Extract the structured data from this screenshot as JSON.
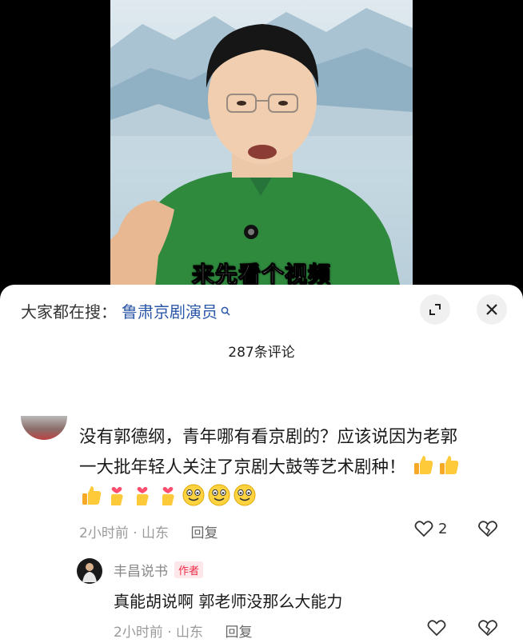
{
  "video": {
    "caption": "来先看个视频"
  },
  "search": {
    "prefix": "大家都在搜：",
    "term": "鲁肃京剧演员"
  },
  "comments_header": {
    "count_text": "287条评论"
  },
  "comment": {
    "line1": "没有郭德纲，青年哪有看京剧的？应该说因为老郭",
    "line2": "一大批年轻人关注了京剧大鼓等艺术剧种！",
    "emojis_line2": [
      "thumbs-up",
      "thumbs-up"
    ],
    "emojis_line3": [
      "thumbs-up",
      "finger-heart",
      "finger-heart",
      "finger-heart",
      "smile",
      "smile",
      "smile"
    ],
    "time": "2小时前",
    "location": "山东",
    "reply_label": "回复",
    "like_count": "2"
  },
  "reply": {
    "author": "丰昌说书",
    "badge": "作者",
    "text": "真能胡说啊 郭老师没那么大能力",
    "time": "2小时前",
    "location": "山东",
    "reply_label": "回复"
  },
  "colors": {
    "link": "#2b57a8",
    "badge_text": "#ee2b47",
    "badge_bg": "#fde7ea",
    "coat": "#2f8a3e"
  }
}
